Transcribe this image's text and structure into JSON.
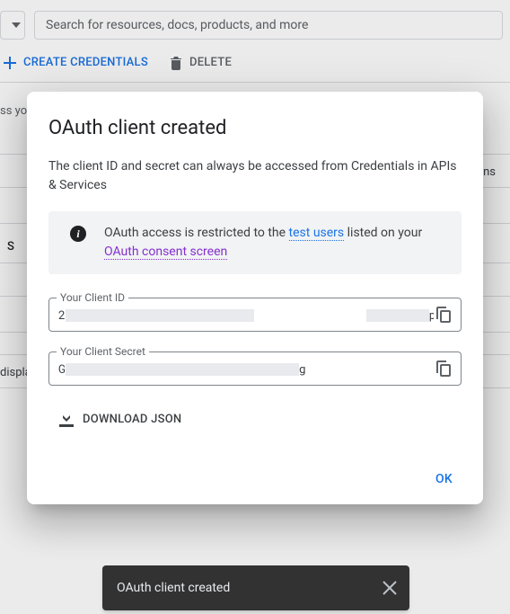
{
  "search": {
    "placeholder": "Search for resources, docs, products, and more"
  },
  "actions": {
    "create": "CREATE CREDENTIALS",
    "delete": "DELETE"
  },
  "bg": {
    "desc_tail": "ss you",
    "row_tail": "ns",
    "section": "S",
    "footer": "displa"
  },
  "modal": {
    "title": "OAuth client created",
    "subtitle": "The client ID and secret can always be accessed from Credentials in APIs & Services",
    "info_prefix": "OAuth access is restricted to the ",
    "info_link1": "test users",
    "info_mid": " listed on your ",
    "info_link2": "OAuth consent screen",
    "client_id_label": "Your Client ID",
    "client_id_head": "2",
    "client_id_tail": "ps.g",
    "client_secret_label": "Your Client Secret",
    "client_secret_head": "G",
    "client_secret_tail": "g",
    "download": "DOWNLOAD JSON",
    "ok": "OK"
  },
  "snackbar": {
    "message": "OAuth client created"
  }
}
